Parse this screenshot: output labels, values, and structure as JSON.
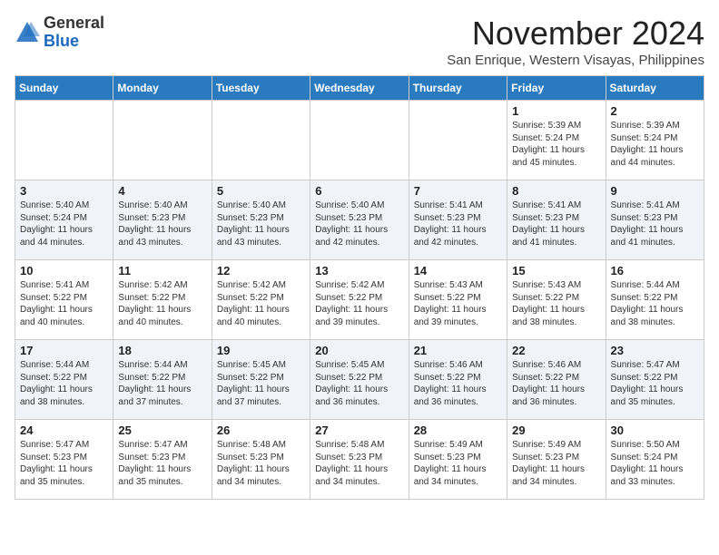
{
  "header": {
    "logo_general": "General",
    "logo_blue": "Blue",
    "month_year": "November 2024",
    "location": "San Enrique, Western Visayas, Philippines"
  },
  "days_of_week": [
    "Sunday",
    "Monday",
    "Tuesday",
    "Wednesday",
    "Thursday",
    "Friday",
    "Saturday"
  ],
  "weeks": [
    [
      {
        "day": "",
        "info": ""
      },
      {
        "day": "",
        "info": ""
      },
      {
        "day": "",
        "info": ""
      },
      {
        "day": "",
        "info": ""
      },
      {
        "day": "",
        "info": ""
      },
      {
        "day": "1",
        "info": "Sunrise: 5:39 AM\nSunset: 5:24 PM\nDaylight: 11 hours and 45 minutes."
      },
      {
        "day": "2",
        "info": "Sunrise: 5:39 AM\nSunset: 5:24 PM\nDaylight: 11 hours and 44 minutes."
      }
    ],
    [
      {
        "day": "3",
        "info": "Sunrise: 5:40 AM\nSunset: 5:24 PM\nDaylight: 11 hours and 44 minutes."
      },
      {
        "day": "4",
        "info": "Sunrise: 5:40 AM\nSunset: 5:23 PM\nDaylight: 11 hours and 43 minutes."
      },
      {
        "day": "5",
        "info": "Sunrise: 5:40 AM\nSunset: 5:23 PM\nDaylight: 11 hours and 43 minutes."
      },
      {
        "day": "6",
        "info": "Sunrise: 5:40 AM\nSunset: 5:23 PM\nDaylight: 11 hours and 42 minutes."
      },
      {
        "day": "7",
        "info": "Sunrise: 5:41 AM\nSunset: 5:23 PM\nDaylight: 11 hours and 42 minutes."
      },
      {
        "day": "8",
        "info": "Sunrise: 5:41 AM\nSunset: 5:23 PM\nDaylight: 11 hours and 41 minutes."
      },
      {
        "day": "9",
        "info": "Sunrise: 5:41 AM\nSunset: 5:23 PM\nDaylight: 11 hours and 41 minutes."
      }
    ],
    [
      {
        "day": "10",
        "info": "Sunrise: 5:41 AM\nSunset: 5:22 PM\nDaylight: 11 hours and 40 minutes."
      },
      {
        "day": "11",
        "info": "Sunrise: 5:42 AM\nSunset: 5:22 PM\nDaylight: 11 hours and 40 minutes."
      },
      {
        "day": "12",
        "info": "Sunrise: 5:42 AM\nSunset: 5:22 PM\nDaylight: 11 hours and 40 minutes."
      },
      {
        "day": "13",
        "info": "Sunrise: 5:42 AM\nSunset: 5:22 PM\nDaylight: 11 hours and 39 minutes."
      },
      {
        "day": "14",
        "info": "Sunrise: 5:43 AM\nSunset: 5:22 PM\nDaylight: 11 hours and 39 minutes."
      },
      {
        "day": "15",
        "info": "Sunrise: 5:43 AM\nSunset: 5:22 PM\nDaylight: 11 hours and 38 minutes."
      },
      {
        "day": "16",
        "info": "Sunrise: 5:44 AM\nSunset: 5:22 PM\nDaylight: 11 hours and 38 minutes."
      }
    ],
    [
      {
        "day": "17",
        "info": "Sunrise: 5:44 AM\nSunset: 5:22 PM\nDaylight: 11 hours and 38 minutes."
      },
      {
        "day": "18",
        "info": "Sunrise: 5:44 AM\nSunset: 5:22 PM\nDaylight: 11 hours and 37 minutes."
      },
      {
        "day": "19",
        "info": "Sunrise: 5:45 AM\nSunset: 5:22 PM\nDaylight: 11 hours and 37 minutes."
      },
      {
        "day": "20",
        "info": "Sunrise: 5:45 AM\nSunset: 5:22 PM\nDaylight: 11 hours and 36 minutes."
      },
      {
        "day": "21",
        "info": "Sunrise: 5:46 AM\nSunset: 5:22 PM\nDaylight: 11 hours and 36 minutes."
      },
      {
        "day": "22",
        "info": "Sunrise: 5:46 AM\nSunset: 5:22 PM\nDaylight: 11 hours and 36 minutes."
      },
      {
        "day": "23",
        "info": "Sunrise: 5:47 AM\nSunset: 5:22 PM\nDaylight: 11 hours and 35 minutes."
      }
    ],
    [
      {
        "day": "24",
        "info": "Sunrise: 5:47 AM\nSunset: 5:23 PM\nDaylight: 11 hours and 35 minutes."
      },
      {
        "day": "25",
        "info": "Sunrise: 5:47 AM\nSunset: 5:23 PM\nDaylight: 11 hours and 35 minutes."
      },
      {
        "day": "26",
        "info": "Sunrise: 5:48 AM\nSunset: 5:23 PM\nDaylight: 11 hours and 34 minutes."
      },
      {
        "day": "27",
        "info": "Sunrise: 5:48 AM\nSunset: 5:23 PM\nDaylight: 11 hours and 34 minutes."
      },
      {
        "day": "28",
        "info": "Sunrise: 5:49 AM\nSunset: 5:23 PM\nDaylight: 11 hours and 34 minutes."
      },
      {
        "day": "29",
        "info": "Sunrise: 5:49 AM\nSunset: 5:23 PM\nDaylight: 11 hours and 34 minutes."
      },
      {
        "day": "30",
        "info": "Sunrise: 5:50 AM\nSunset: 5:24 PM\nDaylight: 11 hours and 33 minutes."
      }
    ]
  ]
}
